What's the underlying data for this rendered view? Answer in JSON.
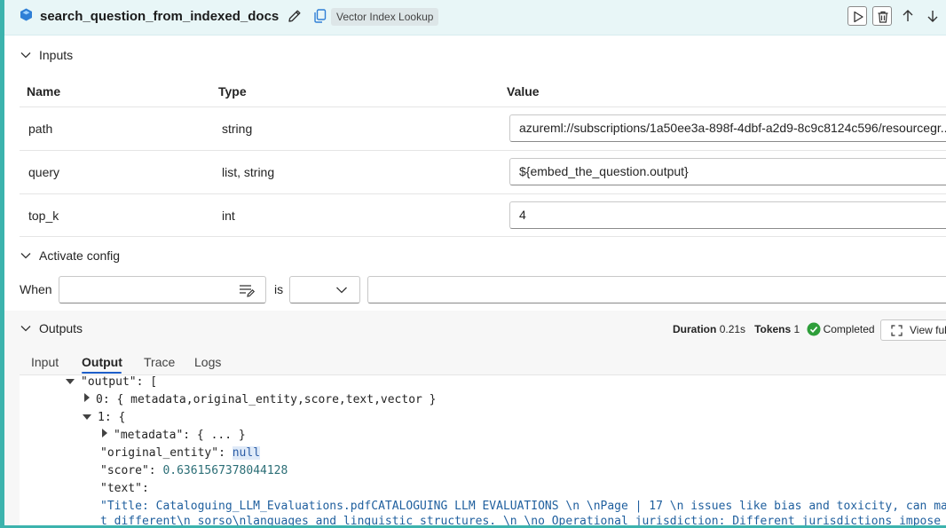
{
  "header": {
    "title": "search_question_from_indexed_docs",
    "tool_badge": "Vector Index Lookup"
  },
  "inputs": {
    "section_label": "Inputs",
    "columns": {
      "name": "Name",
      "type": "Type",
      "value": "Value"
    },
    "rows": [
      {
        "name": "path",
        "type": "string",
        "value": "azureml://subscriptions/1a50ee3a-898f-4dbf-a2d9-8c9c8124c596/resourcegr..."
      },
      {
        "name": "query",
        "type": "list, string",
        "value": "${embed_the_question.output}"
      },
      {
        "name": "top_k",
        "type": "int",
        "value": "4"
      }
    ]
  },
  "activate_config": {
    "section_label": "Activate config",
    "when_label": "When",
    "is_label": "is"
  },
  "outputs": {
    "section_label": "Outputs",
    "duration_label": "Duration",
    "duration_value": "0.21s",
    "tokens_label": "Tokens",
    "tokens_value": "1",
    "status": "Completed",
    "view_full": "View full",
    "tabs": [
      "Input",
      "Output",
      "Trace",
      "Logs"
    ],
    "active_tab": "Output",
    "json": {
      "output_key": "\"output\"",
      "output_open": ": [",
      "item0_key": "0",
      "item0_summary": ": { metadata,original_entity,score,text,vector }",
      "item1_key": "1",
      "item1_open": ": {",
      "metadata_key": "\"metadata\"",
      "metadata_summary": ": { ... }",
      "original_entity_key": "\"original_entity\"",
      "original_entity_value": "null",
      "score_key": "\"score\"",
      "score_value": "0.6361567378044128",
      "text_key": "\"text\"",
      "text_value": "\"Title: Cataloguing_LLM_Evaluations.pdfCATALOGUING LLM EVALUATIONS \\n \\nPage | 17 \\n issues like bias and toxicity, can manif",
      "text_value_line2": "t different\\n sorso\\nlanguages and linguistic structures. \\n \\no  Operational jurisdiction: Different jurisdictions impose"
    }
  },
  "colors": {
    "accent": "#3cb3ad",
    "header_bg": "#e8f6f7",
    "tab_underline": "#1d5ec9",
    "success": "#2e9e3a"
  }
}
